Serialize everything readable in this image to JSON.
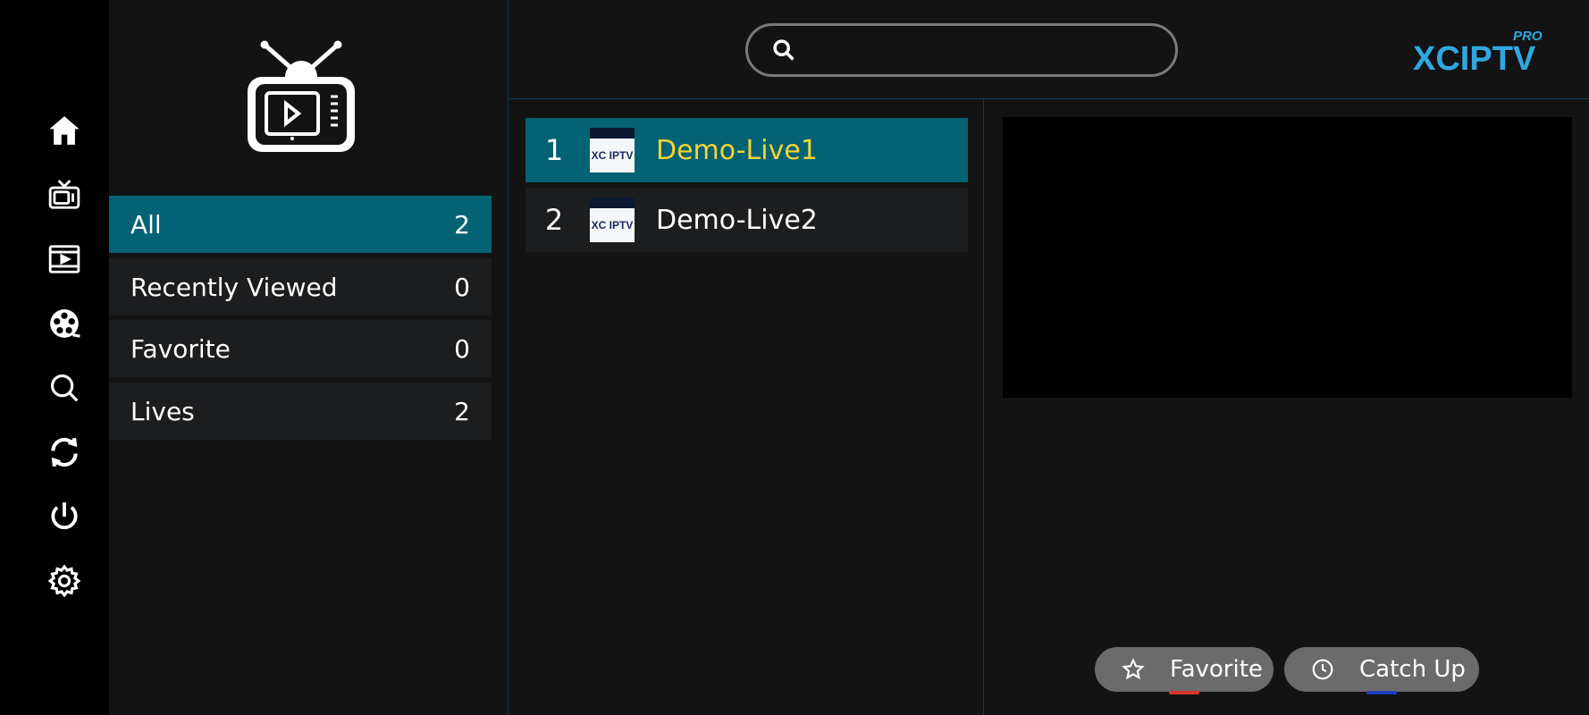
{
  "rail": {
    "items": [
      {
        "icon": "home-icon"
      },
      {
        "icon": "live-tv-icon"
      },
      {
        "icon": "movies-icon"
      },
      {
        "icon": "series-reel-icon"
      },
      {
        "icon": "search-icon"
      },
      {
        "icon": "refresh-icon"
      },
      {
        "icon": "power-icon"
      },
      {
        "icon": "settings-icon"
      }
    ]
  },
  "categories": {
    "items": [
      {
        "label": "All",
        "count": "2",
        "active": true
      },
      {
        "label": "Recently Viewed",
        "count": "0",
        "active": false
      },
      {
        "label": "Favorite",
        "count": "0",
        "active": false
      },
      {
        "label": "Lives",
        "count": "2",
        "active": false
      }
    ]
  },
  "search": {
    "placeholder": "",
    "value": ""
  },
  "brand": {
    "name": "XCIPTV",
    "badge": "PRO",
    "color": "#2fa8e0"
  },
  "channels": {
    "items": [
      {
        "number": "1",
        "name": "Demo-Live1",
        "logo_text": "XC IPTV",
        "active": true
      },
      {
        "number": "2",
        "name": "Demo-Live2",
        "logo_text": "XC IPTV",
        "active": false
      }
    ]
  },
  "actions": {
    "favorite_label": "Favorite",
    "catchup_label": "Catch Up",
    "favorite_color": "#d9352b",
    "catchup_color": "#1e3fbf"
  },
  "colors": {
    "accent": "#046275",
    "active_channel_text": "#f3d431"
  }
}
